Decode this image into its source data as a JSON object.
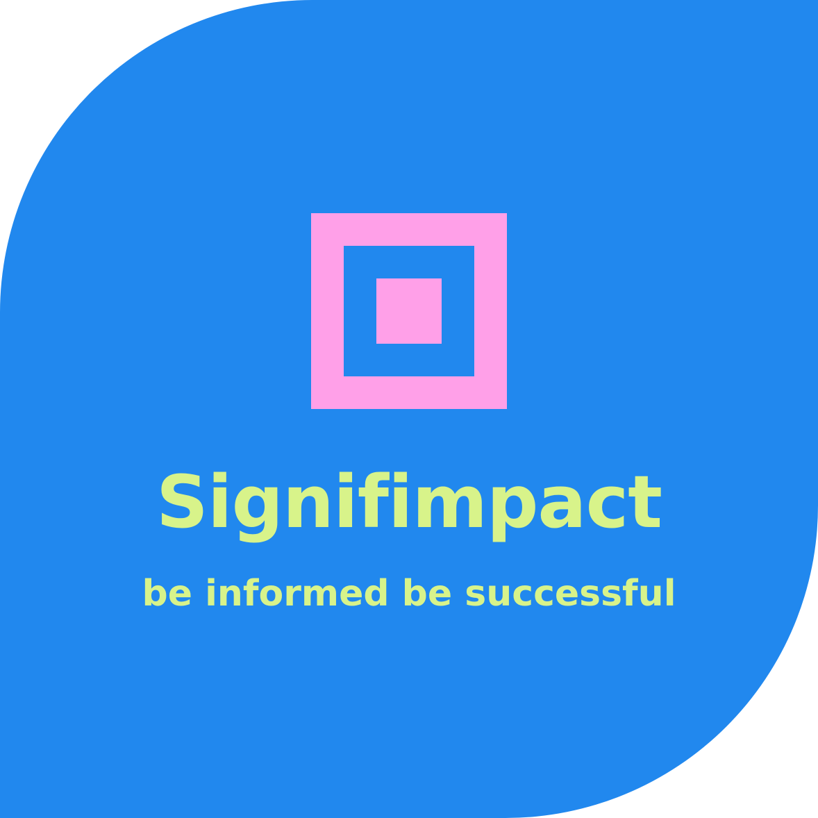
{
  "logo": {
    "name": "Signifimpact",
    "tagline": "be informed be successful",
    "emblem_icon": "concentric-squares-icon"
  },
  "colors": {
    "background": "#2188ee",
    "emblem": "#ffa0e8",
    "text": "#d8f38a",
    "page": "#ffffff"
  }
}
